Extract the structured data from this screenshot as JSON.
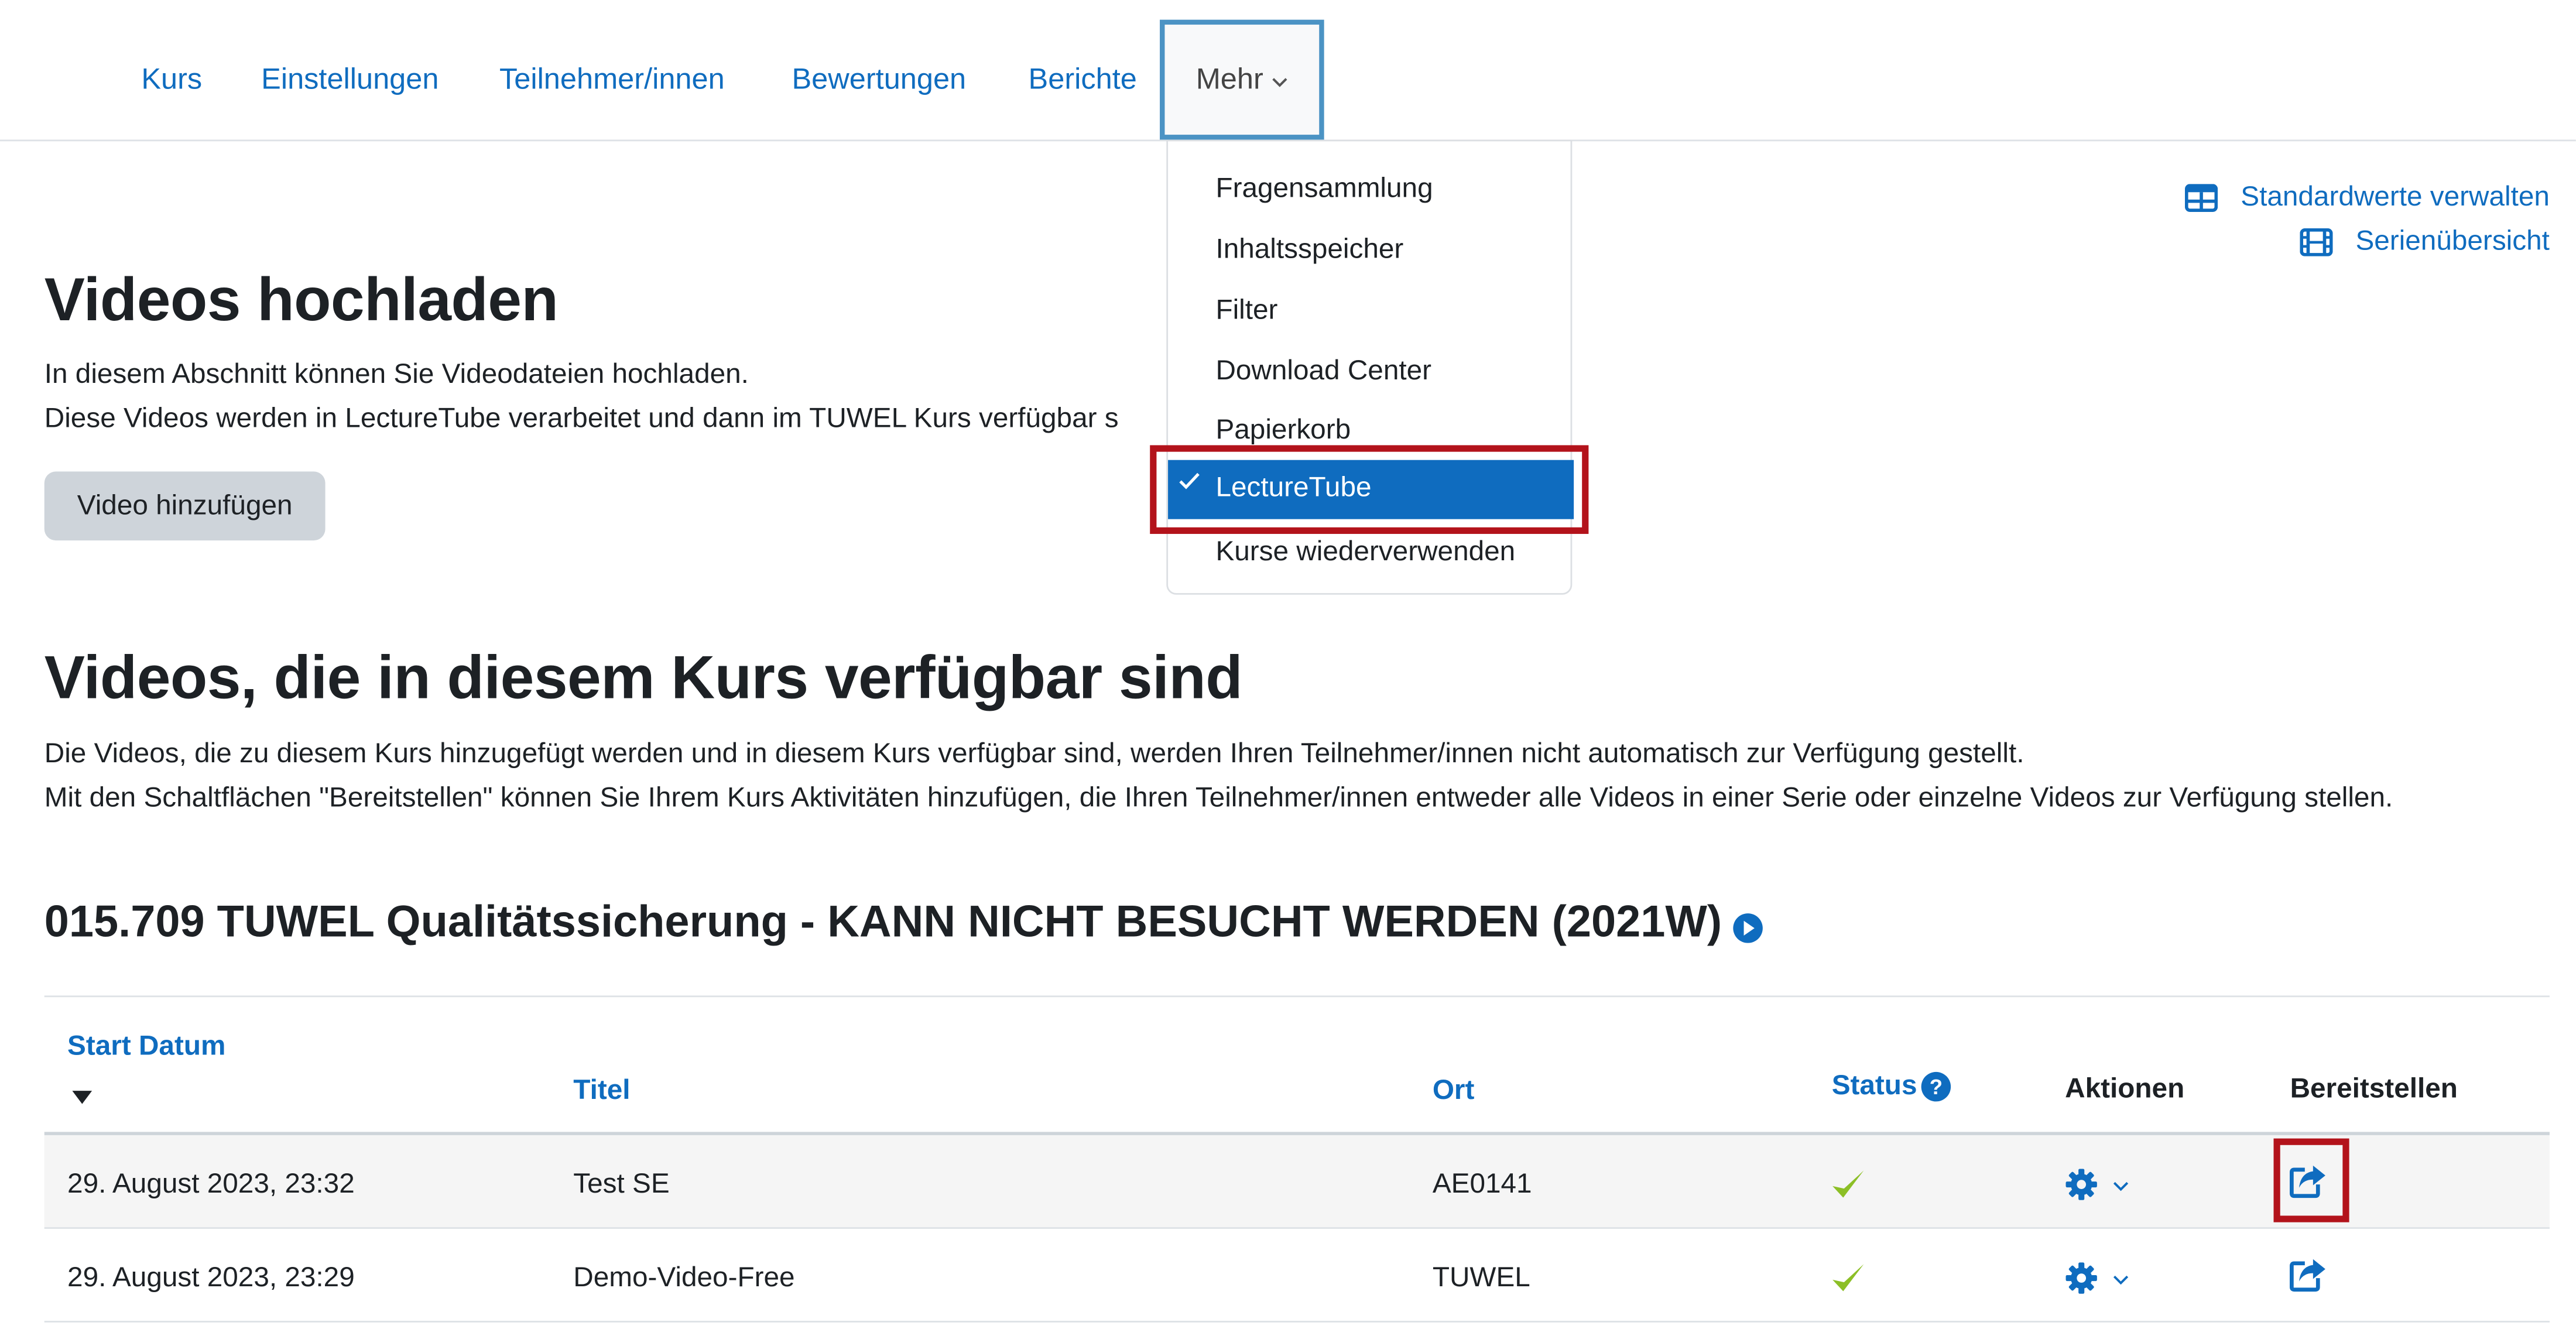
{
  "nav": {
    "items": [
      "Kurs",
      "Einstellungen",
      "Teilnehmer/innen",
      "Bewertungen",
      "Berichte"
    ],
    "more_label": "Mehr"
  },
  "dropdown": {
    "items": [
      "Fragensammlung",
      "Inhaltsspeicher",
      "Filter",
      "Download Center",
      "Papierkorb"
    ],
    "active": "LectureTube",
    "last": "Kurse wiederverwenden"
  },
  "links": {
    "defaults": "Standardwerte verwalten",
    "series": "Serienübersicht"
  },
  "upload": {
    "title": "Videos hochladen",
    "line1": "In diesem Abschnitt können Sie Videodateien hochladen.",
    "line2": "Diese Videos werden in LectureTube verarbeitet und dann im TUWEL Kurs verfügbar s",
    "button": "Video hinzufügen"
  },
  "available": {
    "title": "Videos, die in diesem Kurs verfügbar sind",
    "line1": "Die Videos, die zu diesem Kurs hinzugefügt werden und in diesem Kurs verfügbar sind, werden Ihren Teilnehmer/innen nicht automatisch zur Verfügung gestellt.",
    "line2": "Mit den Schaltflächen \"Bereitstellen\" können Sie Ihrem Kurs Aktivitäten hinzufügen, die Ihren Teilnehmer/innen entweder alle Videos in einer Serie oder einzelne Videos zur Verfügung stellen."
  },
  "series_title": "015.709 TUWEL Qualitätssicherung - KANN NICHT BESUCHT WERDEN (2021W)",
  "table": {
    "headers": {
      "start": "Start Datum",
      "title": "Titel",
      "location": "Ort",
      "status": "Status",
      "actions": "Aktionen",
      "provide": "Bereitstellen"
    },
    "rows": [
      {
        "date": "29. August 2023, 23:32",
        "title": "Test SE",
        "location": "AE0141"
      },
      {
        "date": "29. August 2023, 23:29",
        "title": "Demo-Video-Free",
        "location": "TUWEL"
      }
    ]
  },
  "colors": {
    "link": "#0f6cbf",
    "highlight": "#b3131b",
    "status_ok": "#8cbf26"
  }
}
